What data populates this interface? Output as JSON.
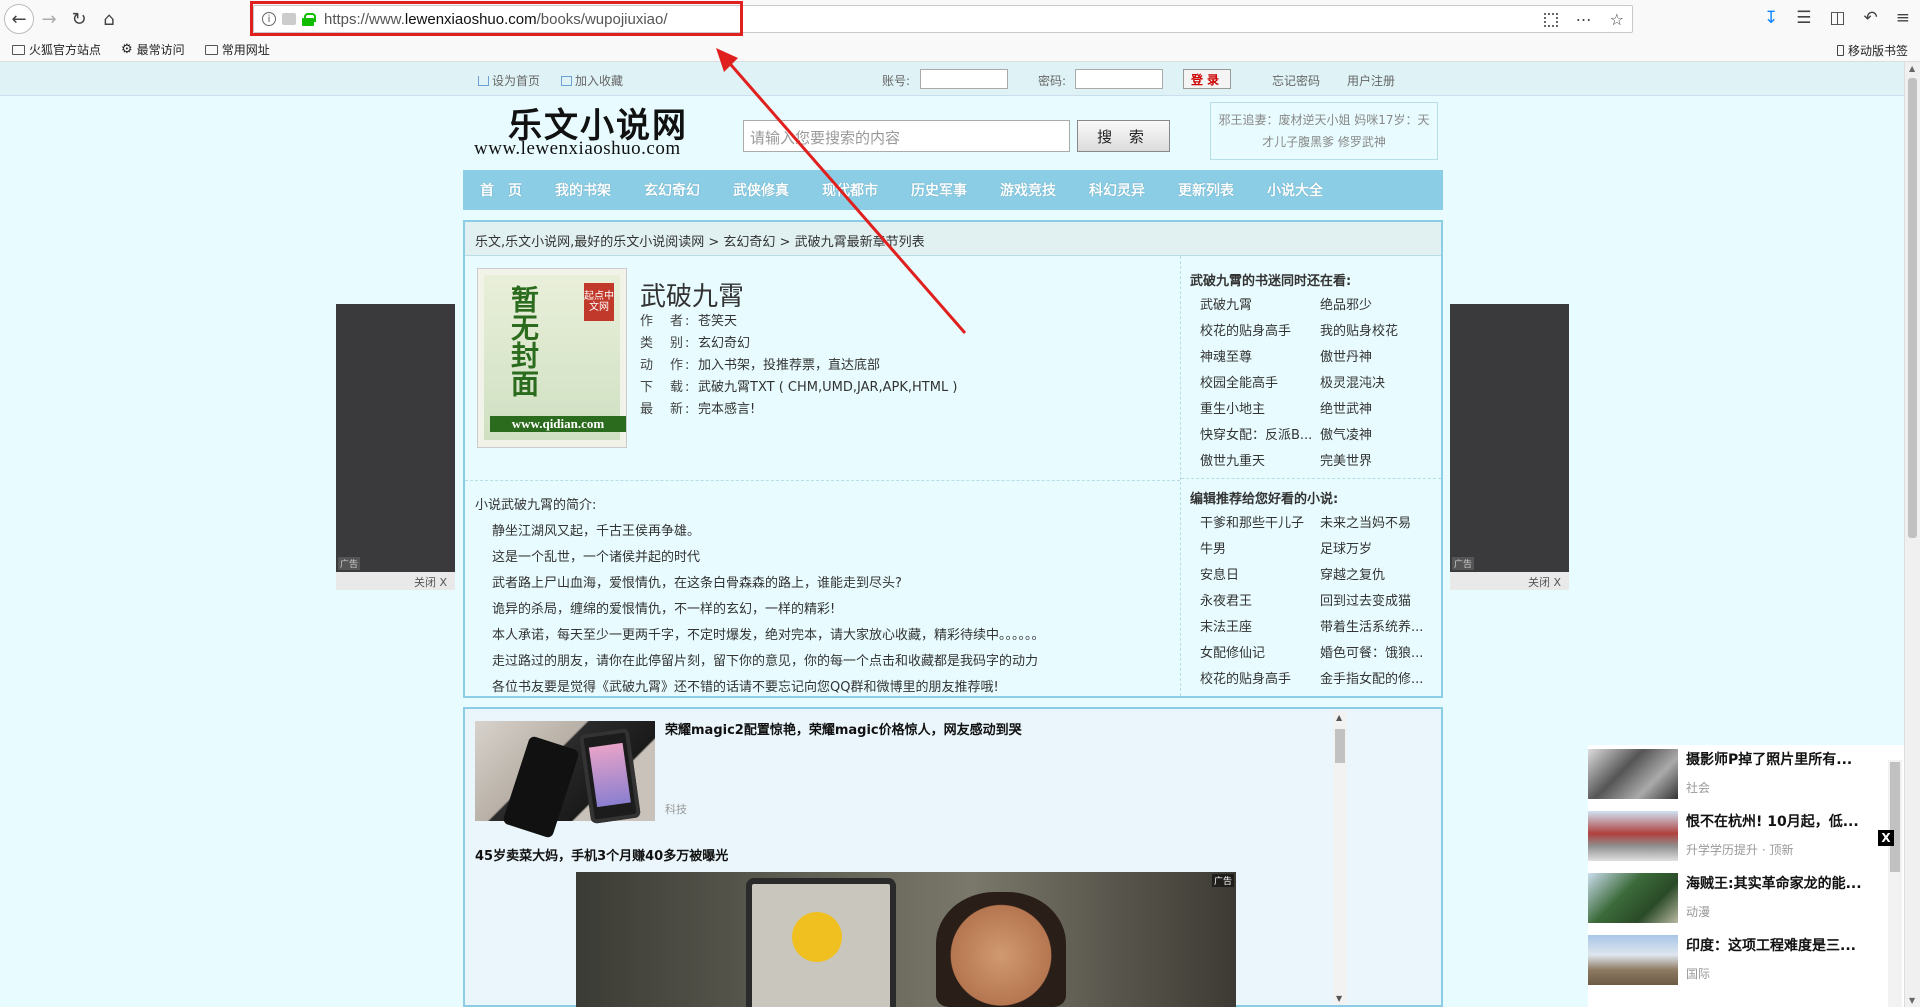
{
  "browser": {
    "url_prefix": "https://www.",
    "url_domain": "lewenxiaoshuo.com",
    "url_path": "/books/wupojiuxiao/",
    "bookmarks": [
      "火狐官方站点",
      "最常访问",
      "常用网址"
    ],
    "mobile_bookmarks": "移动版书签"
  },
  "topbar": {
    "set_home": "设为首页",
    "add_fav": "加入收藏",
    "account_label": "账号:",
    "password_label": "密码:",
    "login": "登录",
    "forgot": "忘记密码",
    "register": "用户注册"
  },
  "header": {
    "logo_main": "乐文小说网",
    "logo_sub": "www.lewenxiaoshuo.com",
    "search_placeholder": "请输入您要搜索的内容",
    "search_button": "搜 索",
    "hot_line1": "邪王追妻：废材逆天小姐  妈咪17岁：天",
    "hot_line2": "才儿子腹黑爹  修罗武神"
  },
  "nav": [
    "首　页",
    "我的书架",
    "玄幻奇幻",
    "武侠修真",
    "现代都市",
    "历史军事",
    "游戏竞技",
    "科幻灵异",
    "更新列表",
    "小说大全"
  ],
  "breadcrumb": "乐文,乐文小说网,最好的乐文小说阅读网 > 玄幻奇幻 > 武破九霄最新章节列表",
  "book": {
    "cover_text": "暂无封面",
    "cover_badge": "起点中文网",
    "cover_url": "www.qidian.com",
    "title": "武破九霄",
    "rows": [
      {
        "k": "作　者:",
        "v": "苍笑天"
      },
      {
        "k": "类　别:",
        "v": "玄幻奇幻"
      },
      {
        "k": "动　作:",
        "v": "加入书架，投推荐票，直达底部"
      },
      {
        "k": "下　载:",
        "v": "武破九霄TXT ( CHM,UMD,JAR,APK,HTML )"
      },
      {
        "k": "最　新:",
        "v": "完本感言!"
      }
    ],
    "intro_title": "小说武破九霄的简介:",
    "intro": [
      "静坐江湖风又起，千古王侯再争雄。",
      "这是一个乱世，一个诸侯并起的时代",
      "武者路上尸山血海，爱恨情仇，在这条白骨森森的路上，谁能走到尽头?",
      "诡异的杀局，缠绵的爱恨情仇，不一样的玄幻，一样的精彩!",
      "本人承诺，每天至少一更两千字，不定时爆发，绝对完本，请大家放心收藏，精彩待续中。。。。。。",
      "走过路过的朋友，请你在此停留片刻，留下你的意见，你的每一个点击和收藏都是我码字的动力",
      "各位书友要是觉得《武破九霄》还不错的话请不要忘记向您QQ群和微博里的朋友推荐哦!"
    ]
  },
  "sidebar": {
    "h1": "武破九霄的书迷同时还在看:",
    "list1": [
      "武破九霄",
      "绝品邪少",
      "校花的贴身高手",
      "我的贴身校花",
      "神魂至尊",
      "傲世丹神",
      "校园全能高手",
      "极灵混沌决",
      "重生小地主",
      "绝世武神",
      "快穿女配：反派B...",
      "傲气凌神",
      "傲世九重天",
      "完美世界"
    ],
    "h2": "编辑推荐给您好看的小说:",
    "list2": [
      "干爹和那些干儿子",
      "未来之当妈不易",
      "牛男",
      "足球万岁",
      "安息日",
      "穿越之复仇",
      "永夜君王",
      "回到过去变成猫",
      "末法王座",
      "带着生活系统养...",
      "女配修仙记",
      "婚色可餐：饿狼...",
      "校花的贴身高手",
      "金手指女配的修..."
    ]
  },
  "ads": {
    "close": "关闭 X",
    "tag": "广告"
  },
  "feed": {
    "item1_title": "荣耀magic2配置惊艳，荣耀magic价格惊人，网友感动到哭",
    "item1_tag": "科技",
    "item2_title": "45岁卖菜大妈，手机3个月赚40多万被曝光",
    "item2_tag": "广告"
  },
  "news": [
    {
      "title": "摄影师P掉了照片里所有...",
      "src": "社会"
    },
    {
      "title": "恨不在杭州! 10月起，低...",
      "src": "升学学历提升 · 顶新"
    },
    {
      "title": "海贼王:其实革命家龙的能...",
      "src": "动漫"
    },
    {
      "title": "印度：这项工程难度是三...",
      "src": "国际"
    }
  ],
  "news_close": "X"
}
